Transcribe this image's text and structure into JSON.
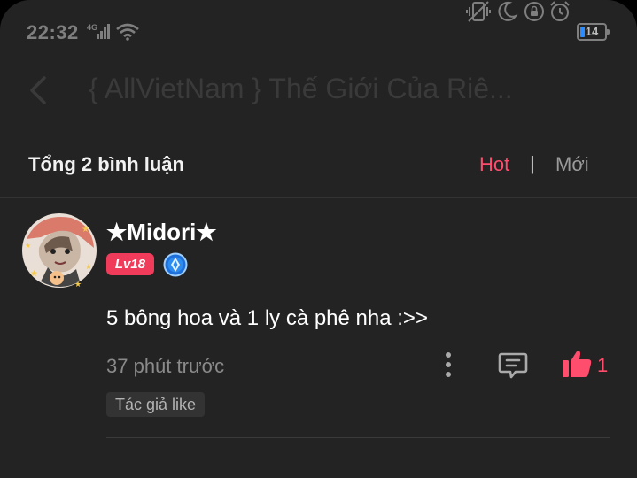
{
  "status_bar": {
    "time": "22:32",
    "network": "4G",
    "battery": "14"
  },
  "header": {
    "title": "{ AllVietNam } Thế Giới Của Riê..."
  },
  "comments_bar": {
    "total": "Tổng 2 bình luận",
    "sort_hot": "Hot",
    "separator": "|",
    "sort_new": "Mới"
  },
  "comment": {
    "username": "★Midori★",
    "level": "Lv18",
    "text": "5 bông hoa và 1 ly cà phê nha :>>",
    "time_ago": "37 phút trước",
    "like_count": "1",
    "tag": "Tác giả like"
  },
  "colors": {
    "background": "#232323",
    "accent": "#ff4d6d",
    "level_badge": "#f03c5a"
  }
}
